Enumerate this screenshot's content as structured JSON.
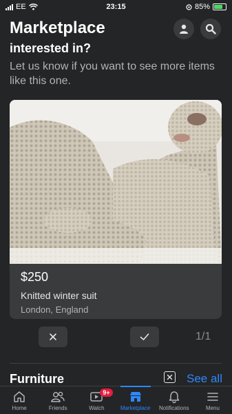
{
  "status": {
    "carrier": "EE",
    "time": "23:15",
    "battery": "85%",
    "battery_level": 0.85
  },
  "header": {
    "title": "Marketplace",
    "icons": [
      "profile-icon",
      "search-icon"
    ]
  },
  "prompt": {
    "title": "interested in?",
    "body": "Let us know if you want to see more items like this one."
  },
  "listing": {
    "price": "$250",
    "title": "Knitted winter suit",
    "location": "London, England"
  },
  "actions": {
    "dismiss_icon": "close-icon",
    "accept_icon": "check-icon",
    "pager": "1/1"
  },
  "section": {
    "title": "Furniture",
    "see_all": "See all"
  },
  "tabbar": {
    "items": [
      {
        "label": "Home",
        "icon": "home-icon"
      },
      {
        "label": "Friends",
        "icon": "friends-icon"
      },
      {
        "label": "Watch",
        "icon": "watch-icon",
        "badge": "9+"
      },
      {
        "label": "Marketplace",
        "icon": "marketplace-icon",
        "active": true
      },
      {
        "label": "Notifications",
        "icon": "bell-icon"
      },
      {
        "label": "Menu",
        "icon": "menu-icon"
      }
    ]
  },
  "colors": {
    "background": "#242526",
    "card": "#3a3b3c",
    "accent": "#2d88ff",
    "badge": "#e41e3f"
  }
}
